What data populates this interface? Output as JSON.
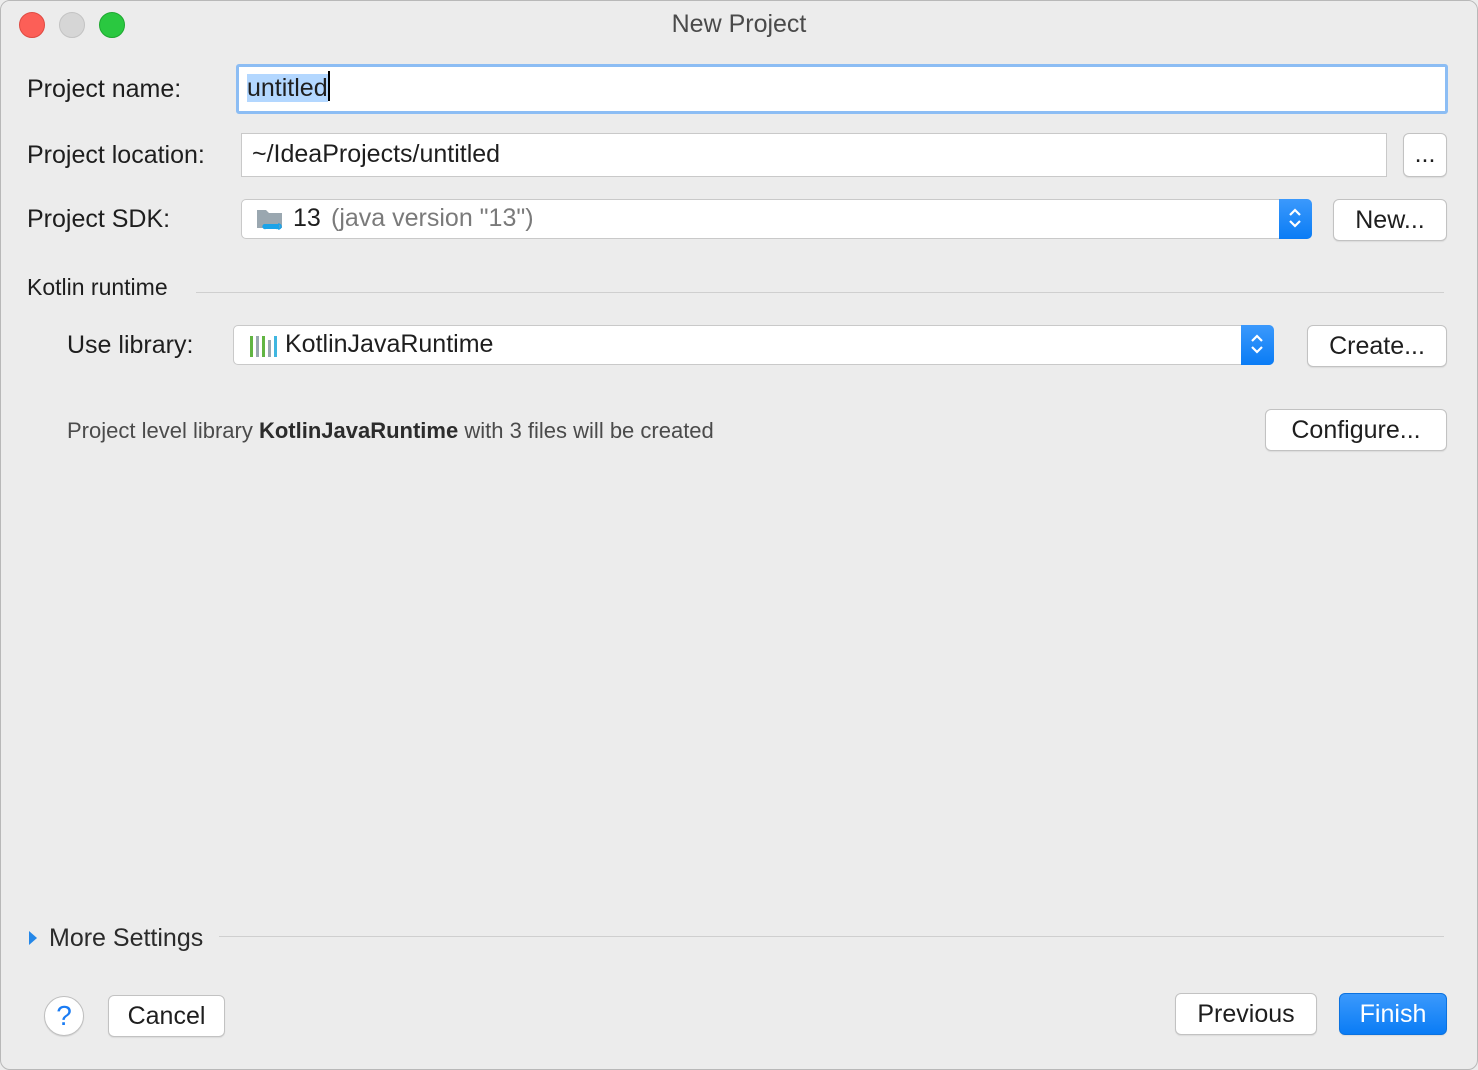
{
  "window": {
    "title": "New Project"
  },
  "project_name": {
    "label": "Project name:",
    "value": "untitled"
  },
  "project_location": {
    "label": "Project location:",
    "value": "~/IdeaProjects/untitled",
    "browse_label": "..."
  },
  "project_sdk": {
    "label": "Project SDK:",
    "version": "13",
    "detail": "(java version \"13\")",
    "new_label": "New...",
    "icon": "jdk-folder-icon"
  },
  "kotlin_runtime": {
    "section_title": "Kotlin runtime",
    "use_library_label": "Use library:",
    "library_value": "KotlinJavaRuntime",
    "library_icon": "library-icon",
    "create_label": "Create...",
    "hint_prefix": "Project level library ",
    "hint_bold": "KotlinJavaRuntime",
    "hint_suffix": " with 3 files will be created",
    "configure_label": "Configure..."
  },
  "more_settings": {
    "label": "More Settings"
  },
  "footer": {
    "help_label": "?",
    "cancel_label": "Cancel",
    "previous_label": "Previous",
    "finish_label": "Finish"
  },
  "colors": {
    "accent": "#0a7cf5",
    "selection": "#b3d7ff",
    "focus_ring": "#8cbdf4"
  }
}
